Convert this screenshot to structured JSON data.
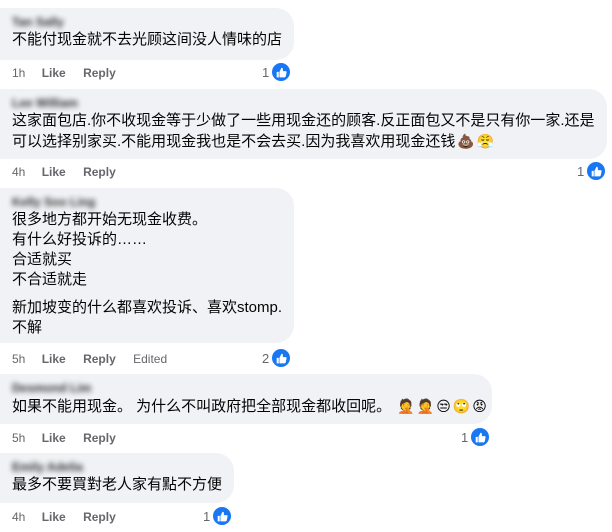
{
  "comments": [
    {
      "author": "Tan Sally",
      "lines": [
        "不能付现金就不去光顾这间没人情味的店"
      ],
      "time": "1h",
      "like": "Like",
      "reply": "Reply",
      "edited": "",
      "reactions": "1"
    },
    {
      "author": "Lee William",
      "lines": [
        "这家面包店.你不收现金等于少做了一些用现金还的顾客.反正面包又不是只有你一家.还是",
        "可以选择别家买.不能用现金我也是不会去买.因为我喜欢用现金还钱"
      ],
      "emojis": [
        "💩",
        "😤"
      ],
      "time": "4h",
      "like": "Like",
      "reply": "Reply",
      "edited": "",
      "reactions": "1"
    },
    {
      "author": "Kelly Soo Ling",
      "lines": [
        "很多地方都开始无现金收费。",
        "有什么好投诉的……",
        "合适就买",
        "不合适就走",
        "",
        "新加坡变的什么都喜欢投诉、喜欢stomp.",
        "不解"
      ],
      "time": "5h",
      "like": "Like",
      "reply": "Reply",
      "edited": "Edited",
      "reactions": "2"
    },
    {
      "author": "Desmond Lim",
      "lines": [
        "如果不能用现金。 为什么不叫政府把全部现金都收回呢。"
      ],
      "emojis": [
        "🤦",
        "🤦",
        "😒",
        "🙄",
        "😡"
      ],
      "time": "5h",
      "like": "Like",
      "reply": "Reply",
      "edited": "",
      "reactions": "1"
    },
    {
      "author": "Emily Adelia",
      "lines": [
        "最多不要買對老人家有點不方便"
      ],
      "time": "4h",
      "like": "Like",
      "reply": "Reply",
      "edited": "",
      "reactions": "1"
    }
  ],
  "colors": {
    "bubble": "#f0f2f5",
    "meta": "#65676b",
    "like_badge": "#1877f2"
  },
  "icons": {
    "reaction": "thumbs-up-icon"
  }
}
